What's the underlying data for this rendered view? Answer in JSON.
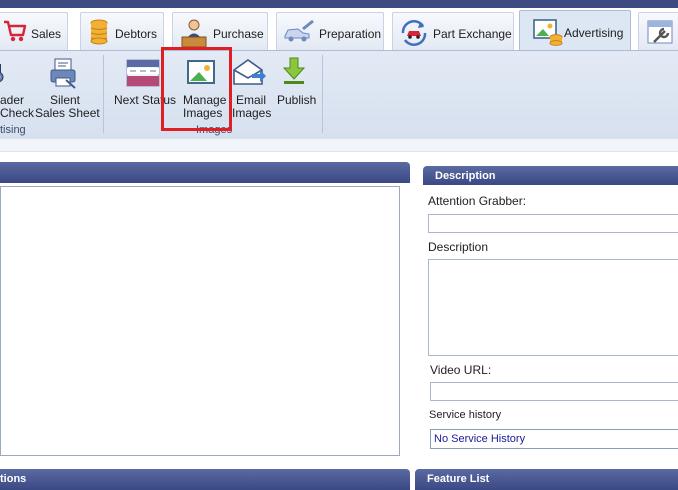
{
  "tabs": [
    {
      "label": "Sales",
      "icon": "cart-icon"
    },
    {
      "label": "Debtors",
      "icon": "coins-icon"
    },
    {
      "label": "Purchase",
      "icon": "person-desk-icon"
    },
    {
      "label": "Preparation",
      "icon": "car-wrench-icon"
    },
    {
      "label": "Part Exchange",
      "icon": "car-exchange-icon"
    },
    {
      "label": "Advertising",
      "icon": "image-coins-icon"
    }
  ],
  "ribbon": {
    "partial_buttons": [
      {
        "line1": "ader",
        "line2": "Check"
      },
      {
        "line1": "Silent",
        "line2": "Sales Sheet"
      }
    ],
    "partial_group_label": "tising",
    "buttons": [
      {
        "line1": "Next Status",
        "line2": ""
      },
      {
        "line1": "Manage",
        "line2": "Images"
      },
      {
        "line1": "Email",
        "line2": "Images"
      },
      {
        "line1": "Publish",
        "line2": ""
      }
    ],
    "group_label": "Images"
  },
  "panels": {
    "bottom_left_title": "tions",
    "description_title": "Description",
    "feature_list_title": "Feature List"
  },
  "description": {
    "attention_grabber_label": "Attention Grabber:",
    "attention_grabber_value": "",
    "description_label": "Description",
    "description_value": "",
    "video_url_label": "Video URL:",
    "video_url_value": "",
    "service_history_label": "Service history",
    "service_history_value": "No Service History"
  },
  "colors": {
    "panel_header": "#3a4884",
    "highlight": "#e01f24",
    "link_text": "#1a1a9c"
  }
}
